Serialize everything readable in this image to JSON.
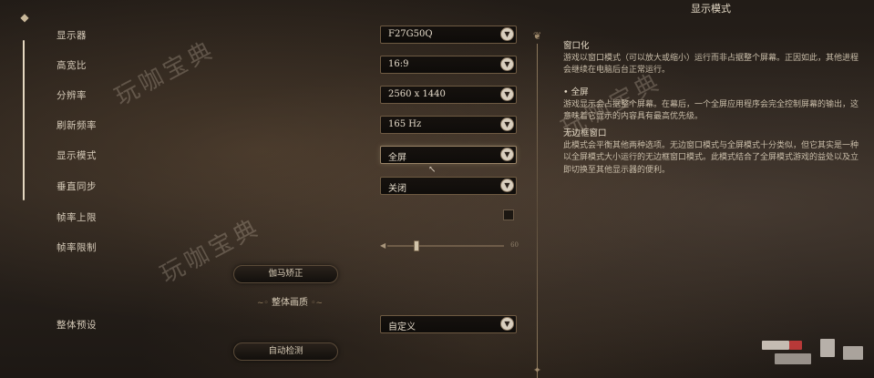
{
  "right_panel": {
    "title": "显示模式",
    "sections": [
      {
        "heading": "窗口化",
        "body": "游戏以窗口模式（可以放大或缩小）运行而非占据整个屏幕。正因如此，其他进程会继续在电脑后台正常运行。"
      },
      {
        "heading": "• 全屏",
        "body": "游戏显示会占据整个屏幕。在幕后，一个全屏应用程序会完全控制屏幕的输出，这意味着它显示的内容具有最高优先级。"
      },
      {
        "heading": "无边框窗口",
        "body": "此模式会平衡其他两种选项。无边窗口模式与全屏模式十分类似，但它其实是一种以全屏模式大小运行的无边框窗口模式。此模式结合了全屏模式游戏的益处以及立即切换至其他显示器的便利。"
      }
    ]
  },
  "settings": {
    "display": {
      "label": "显示器",
      "value": "F27G50Q"
    },
    "aspect": {
      "label": "高宽比",
      "value": "16:9"
    },
    "resolution": {
      "label": "分辨率",
      "value": "2560 x 1440"
    },
    "refresh": {
      "label": "刷新频率",
      "value": "165 Hz"
    },
    "mode": {
      "label": "显示模式",
      "value": "全屏"
    },
    "vsync": {
      "label": "垂直同步",
      "value": "关闭"
    },
    "fps_cap": {
      "label": "帧率上限",
      "checked": false
    },
    "fps_limit": {
      "label": "帧率限制",
      "value": "60",
      "level": 0.25
    },
    "preset": {
      "label": "整体预设",
      "value": "自定义"
    }
  },
  "buttons": {
    "gamma": "伽马矫正",
    "auto_detect": "自动检测"
  },
  "section_heading": "整体画质",
  "watermark": "玩咖宝典",
  "icons": {
    "rail_top": "settings-emblem-icon",
    "dropdown": "chevron-down-icon"
  },
  "colors": {
    "accent": "#d9cfbf",
    "border": "#6e5a42"
  }
}
